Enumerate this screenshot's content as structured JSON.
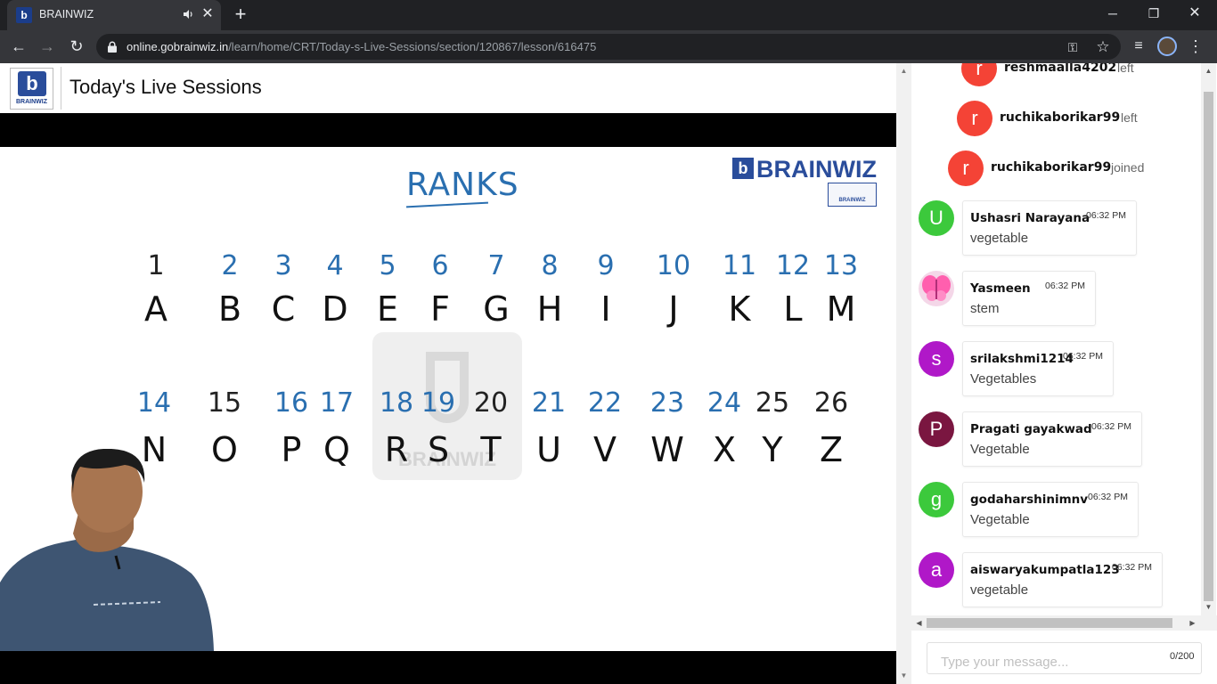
{
  "browser": {
    "tab_title": "BRAINWIZ",
    "tab_favicon": "b",
    "close_glyph": "✕",
    "newtab_glyph": "+",
    "window": {
      "minimize": "─",
      "restore": "❐",
      "close": "✕"
    },
    "nav": {
      "back": "←",
      "forward": "→",
      "reload": "↻"
    },
    "url_host": "online.gobrainwiz.in",
    "url_path": "/learn/home/CRT/Today-s-Live-Sessions/section/120867/lesson/616475",
    "icons": [
      "lock-icon",
      "key-icon",
      "star-icon",
      "media-icon",
      "profile-avatar",
      "menu-icon"
    ],
    "glyphs": {
      "key": "⚿",
      "star": "☆",
      "media": "≡",
      "menu": "⋮"
    }
  },
  "header": {
    "logo_letter": "b",
    "logo_text": "BRAINWIZ",
    "title": "Today's Live Sessions"
  },
  "board": {
    "title": "RANKS",
    "brand_letter": "b",
    "brand_text": "BRAINWIZ",
    "brand_badge": "BRAINWIZ",
    "center_watermark": "BRAINWIZ",
    "row1": [
      {
        "n": "1",
        "l": "A"
      },
      {
        "n": "2",
        "l": "B"
      },
      {
        "n": "3",
        "l": "C"
      },
      {
        "n": "4",
        "l": "D"
      },
      {
        "n": "5",
        "l": "E"
      },
      {
        "n": "6",
        "l": "F"
      },
      {
        "n": "7",
        "l": "G"
      },
      {
        "n": "8",
        "l": "H"
      },
      {
        "n": "9",
        "l": "I"
      },
      {
        "n": "10",
        "l": "J"
      },
      {
        "n": "11",
        "l": "K"
      },
      {
        "n": "12",
        "l": "L"
      },
      {
        "n": "13",
        "l": "M"
      }
    ],
    "row2": [
      {
        "n": "14",
        "l": "N"
      },
      {
        "n": "15",
        "l": "O"
      },
      {
        "n": "16",
        "l": "P"
      },
      {
        "n": "17",
        "l": "Q"
      },
      {
        "n": "18",
        "l": "R"
      },
      {
        "n": "19",
        "l": "S"
      },
      {
        "n": "20",
        "l": "T"
      },
      {
        "n": "21",
        "l": "U"
      },
      {
        "n": "22",
        "l": "V"
      },
      {
        "n": "23",
        "l": "W"
      },
      {
        "n": "24",
        "l": "X"
      },
      {
        "n": "25",
        "l": "Y"
      },
      {
        "n": "26",
        "l": "Z"
      }
    ]
  },
  "chat": {
    "system_events": [
      {
        "initial": "r",
        "name": "reshmaalla4202",
        "action": "left"
      },
      {
        "initial": "r",
        "name": "ruchikaborikar99",
        "action": "left"
      },
      {
        "initial": "r",
        "name": "ruchikaborikar99",
        "action": "joined"
      }
    ],
    "messages": [
      {
        "initial": "U",
        "name": "Ushasri Narayana",
        "time": "06:32 PM",
        "text": "vegetable",
        "color": "#3cc93c"
      },
      {
        "initial": "",
        "name": "Yasmeen",
        "time": "06:32 PM",
        "text": "stem",
        "color": "#f4d7e8"
      },
      {
        "initial": "s",
        "name": "srilakshmi1214",
        "time": "06:32 PM",
        "text": "Vegetables",
        "color": "#b018c8"
      },
      {
        "initial": "P",
        "name": "Pragati gayakwad",
        "time": "06:32 PM",
        "text": "Vegetable",
        "color": "#7a1640"
      },
      {
        "initial": "g",
        "name": "godaharshinimnv",
        "time": "06:32 PM",
        "text": "Vegetable",
        "color": "#3cc93c"
      },
      {
        "initial": "a",
        "name": "aiswaryakumpatla123",
        "time": "06:32 PM",
        "text": "vegetable",
        "color": "#b018c8"
      }
    ],
    "system_color": "#f44336",
    "input_placeholder": "Type your message...",
    "char_count": "0/200"
  },
  "scroll_arrows": {
    "up": "▲",
    "down": "▼",
    "left": "◀",
    "right": "▶"
  }
}
